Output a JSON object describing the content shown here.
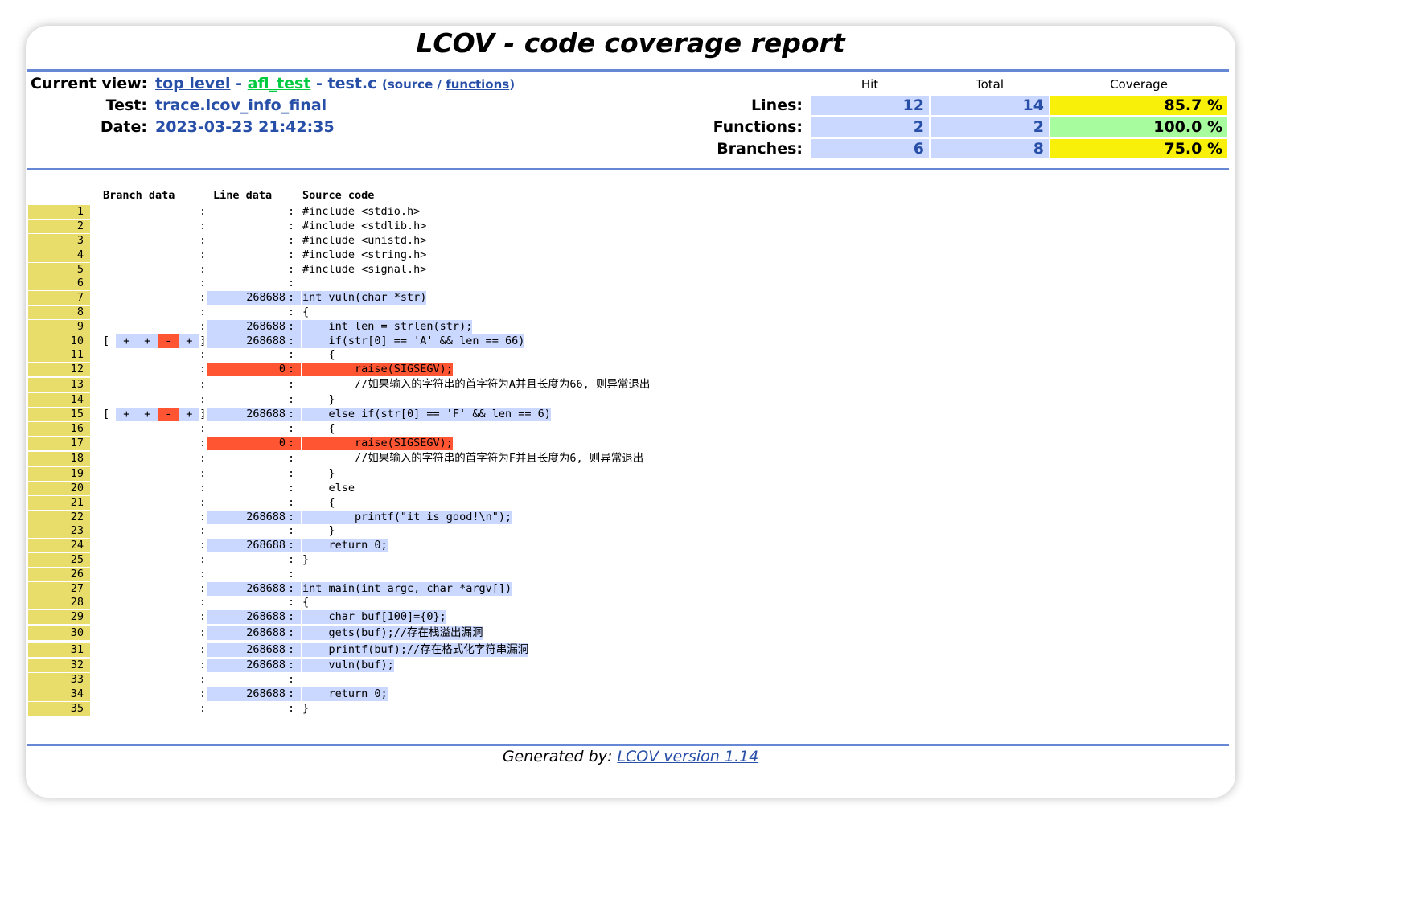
{
  "title": "LCOV - code coverage report",
  "header": {
    "current_view_label": "Current view:",
    "crumb_top": "top level",
    "crumb_sep1": " - ",
    "crumb_dir": "afl_test",
    "crumb_sep2": " - test.c ",
    "paren_open": "(",
    "source_label": "source",
    "slash": " / ",
    "functions_link": "functions",
    "paren_close": ")",
    "test_label": "Test:",
    "test_value": "trace.lcov_info_final",
    "date_label": "Date:",
    "date_value": "2023-03-23 21:42:35"
  },
  "summary": {
    "col_hit": "Hit",
    "col_total": "Total",
    "col_coverage": "Coverage",
    "rows": [
      {
        "label": "Lines:",
        "hit": "12",
        "total": "14",
        "coverage": "85.7 %",
        "level": "med"
      },
      {
        "label": "Functions:",
        "hit": "2",
        "total": "2",
        "coverage": "100.0 %",
        "level": "hi"
      },
      {
        "label": "Branches:",
        "hit": "6",
        "total": "8",
        "coverage": "75.0 %",
        "level": "med"
      }
    ]
  },
  "source_headers": {
    "branch": "Branch data",
    "line": "Line data",
    "source": "Source code"
  },
  "source_lines": [
    {
      "n": "1",
      "count": "",
      "code": "#include <stdio.h>",
      "status": "none"
    },
    {
      "n": "2",
      "count": "",
      "code": "#include <stdlib.h>",
      "status": "none"
    },
    {
      "n": "3",
      "count": "",
      "code": "#include <unistd.h>",
      "status": "none"
    },
    {
      "n": "4",
      "count": "",
      "code": "#include <string.h>",
      "status": "none"
    },
    {
      "n": "5",
      "count": "",
      "code": "#include <signal.h>",
      "status": "none"
    },
    {
      "n": "6",
      "count": "",
      "code": "",
      "status": "none"
    },
    {
      "n": "7",
      "count": "268688",
      "code": "int vuln(char *str)",
      "status": "hit"
    },
    {
      "n": "8",
      "count": "",
      "code": "{",
      "status": "none"
    },
    {
      "n": "9",
      "count": "268688",
      "code": "    int len = strlen(str);",
      "status": "hit"
    },
    {
      "n": "10",
      "count": "268688",
      "code": "    if(str[0] == 'A' && len == 66)",
      "status": "hit",
      "branches": [
        "+",
        "+",
        "-",
        "+"
      ]
    },
    {
      "n": "11",
      "count": "",
      "code": "    {",
      "status": "none"
    },
    {
      "n": "12",
      "count": "0",
      "code": "        raise(SIGSEGV);",
      "status": "miss"
    },
    {
      "n": "13",
      "count": "",
      "code": "        //如果输入的字符串的首字符为A并且长度为66, 则异常退出",
      "status": "none"
    },
    {
      "n": "14",
      "count": "",
      "code": "    }",
      "status": "none"
    },
    {
      "n": "15",
      "count": "268688",
      "code": "    else if(str[0] == 'F' && len == 6)",
      "status": "hit",
      "branches": [
        "+",
        "+",
        "-",
        "+"
      ]
    },
    {
      "n": "16",
      "count": "",
      "code": "    {",
      "status": "none"
    },
    {
      "n": "17",
      "count": "0",
      "code": "        raise(SIGSEGV);",
      "status": "miss"
    },
    {
      "n": "18",
      "count": "",
      "code": "        //如果输入的字符串的首字符为F并且长度为6, 则异常退出",
      "status": "none"
    },
    {
      "n": "19",
      "count": "",
      "code": "    }",
      "status": "none"
    },
    {
      "n": "20",
      "count": "",
      "code": "    else",
      "status": "none"
    },
    {
      "n": "21",
      "count": "",
      "code": "    {",
      "status": "none"
    },
    {
      "n": "22",
      "count": "268688",
      "code": "        printf(\"it is good!\\n\");",
      "status": "hit"
    },
    {
      "n": "23",
      "count": "",
      "code": "    }",
      "status": "none"
    },
    {
      "n": "24",
      "count": "268688",
      "code": "    return 0;",
      "status": "hit"
    },
    {
      "n": "25",
      "count": "",
      "code": "}",
      "status": "none"
    },
    {
      "n": "26",
      "count": "",
      "code": "",
      "status": "none"
    },
    {
      "n": "27",
      "count": "268688",
      "code": "int main(int argc, char *argv[])",
      "status": "hit"
    },
    {
      "n": "28",
      "count": "",
      "code": "{",
      "status": "none"
    },
    {
      "n": "29",
      "count": "268688",
      "code": "    char buf[100]={0};",
      "status": "hit"
    },
    {
      "n": "30",
      "count": "268688",
      "code": "    gets(buf);//存在栈溢出漏洞",
      "status": "hit"
    },
    {
      "n": "31",
      "count": "268688",
      "code": "    printf(buf);//存在格式化字符串漏洞",
      "status": "hit"
    },
    {
      "n": "32",
      "count": "268688",
      "code": "    vuln(buf);",
      "status": "hit"
    },
    {
      "n": "33",
      "count": "",
      "code": "",
      "status": "none"
    },
    {
      "n": "34",
      "count": "268688",
      "code": "    return 0;",
      "status": "hit"
    },
    {
      "n": "35",
      "count": "",
      "code": "}",
      "status": "none"
    }
  ],
  "footer": {
    "prefix": "Generated by: ",
    "link": "LCOV version 1.14"
  },
  "colors": {
    "rule": "#6688d4",
    "hit_bg": "#cad7fe",
    "miss_bg": "#ff5533",
    "linenum_bg": "#e8dc6a",
    "cov_med": "#f8f008",
    "cov_hi": "#a7fc9d",
    "link": "#284fa8",
    "link_dir": "#00cb40"
  }
}
